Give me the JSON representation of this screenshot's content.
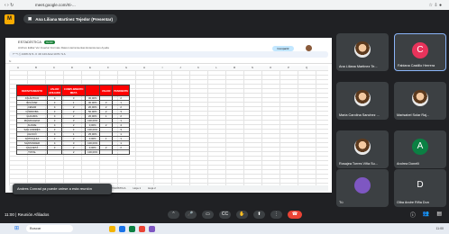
{
  "browser": {
    "url": "meet.google.com/rti-..."
  },
  "meet": {
    "logo": "M",
    "presenter": "Ana Liliana Martinez Tejedor (Presentar)",
    "meeting_title": "11:00 | Reunión Afiliados"
  },
  "sheet": {
    "file": "ESTADÍSTICA",
    "badge": "XLSX",
    "share": "Compartir",
    "columns": [
      "A",
      "B",
      "C",
      "D",
      "E",
      "F",
      "G",
      "H",
      "I",
      "J",
      "K",
      "L",
      "M",
      "N",
      "O",
      "P",
      "Q"
    ],
    "tabs": [
      "ESTADÍSTICA",
      "Hoja 1",
      "Hoja 2"
    ]
  },
  "table": {
    "headers": [
      "DEPARTAMENTO",
      "VALOR AFILIADO",
      "CUMPLIMIENTO META",
      "",
      "VALOR",
      "PENDIENTE"
    ],
    "rows": [
      [
        "ATLÁNTICO",
        "4",
        "3",
        "30,00%",
        "",
        "2"
      ],
      [
        "BOLÍVAR",
        "4",
        "1",
        "30,00%",
        "3",
        "1"
      ],
      [
        "CESAR",
        "4",
        "2",
        "20,00%",
        "2",
        "2"
      ],
      [
        "CÓRDOBA",
        "4",
        "2",
        "50,00%",
        "2",
        "3"
      ],
      [
        "GUAJIRA",
        "4",
        "2",
        "20,00%",
        "1",
        "2"
      ],
      [
        "MAGDALENA",
        "4",
        "3",
        "100,00%",
        "",
        "1"
      ],
      [
        "SUCRE",
        "4",
        "2",
        "0,00%",
        "2",
        "4"
      ],
      [
        "SAN ANDRÉS",
        "4",
        "4",
        "100,00%",
        "",
        "3"
      ],
      [
        "CHOCÓ",
        "4",
        "1",
        "25,00%",
        "",
        "1"
      ],
      [
        "ANTIOQUIA",
        "4",
        "2",
        "0,00%",
        "1",
        "1"
      ],
      [
        "SANTANDER",
        "4",
        "3",
        "100,00%",
        "",
        "1"
      ],
      [
        "CAQUETÁ",
        "4",
        "2",
        "0,00%",
        "2",
        "2"
      ],
      [
        "TOTAL",
        "",
        "2",
        "100,00%",
        "",
        ""
      ]
    ]
  },
  "toast": "Andres Conrad ya puede unirse a esta reunión",
  "participants": [
    {
      "name": "Ana Liliana Martinez Te...",
      "initial": "",
      "color": "photo"
    },
    {
      "name": "Fabiana Castillo Herrera",
      "initial": "C",
      "color": "#e8335b"
    },
    {
      "name": "Maria Carolina Sanchez ...",
      "initial": "",
      "color": "photo"
    },
    {
      "name": "Marisabel Solar Raj...",
      "initial": "",
      "color": "photo"
    },
    {
      "name": "Rosajea Torres Viña Su...",
      "initial": "",
      "color": "photo"
    },
    {
      "name": "Andrea Donelli",
      "initial": "A",
      "color": "#0b8043"
    },
    {
      "name": "Tú",
      "initial": "",
      "color": "#7e57c2"
    },
    {
      "name": "Olba Andre Riña Dun",
      "initial": "D",
      "color": "#3c4043"
    }
  ],
  "taskbar": {
    "search": "Buscar",
    "time": "11:00"
  }
}
